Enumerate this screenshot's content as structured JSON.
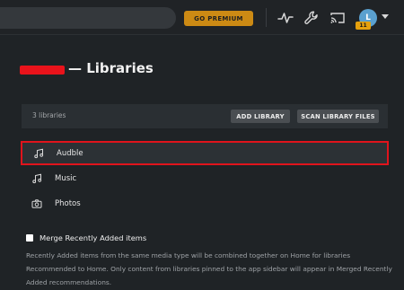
{
  "header": {
    "premium_label": "GO PREMIUM",
    "avatar_initial": "L",
    "badge_count": "11"
  },
  "page": {
    "title": "— Libraries"
  },
  "libraries_header": {
    "count_text": "3 libraries",
    "add_label": "ADD LIBRARY",
    "scan_label": "SCAN LIBRARY FILES"
  },
  "libraries": [
    {
      "name": "Audble",
      "icon": "music-note-icon"
    },
    {
      "name": "Music",
      "icon": "music-note-icon"
    },
    {
      "name": "Photos",
      "icon": "camera-icon"
    }
  ],
  "merge": {
    "label": "Merge Recently Added items",
    "checked": false,
    "description": "Recently Added items from the same media type will be combined together on Home for libraries Recommended to Home. Only content from libraries pinned to the app sidebar will appear in Merged Recently Added recommendations."
  },
  "colors": {
    "background": "#1f2326",
    "premium": "#cc8a14",
    "highlight": "#e0141c",
    "avatar": "#5aa0cf"
  }
}
